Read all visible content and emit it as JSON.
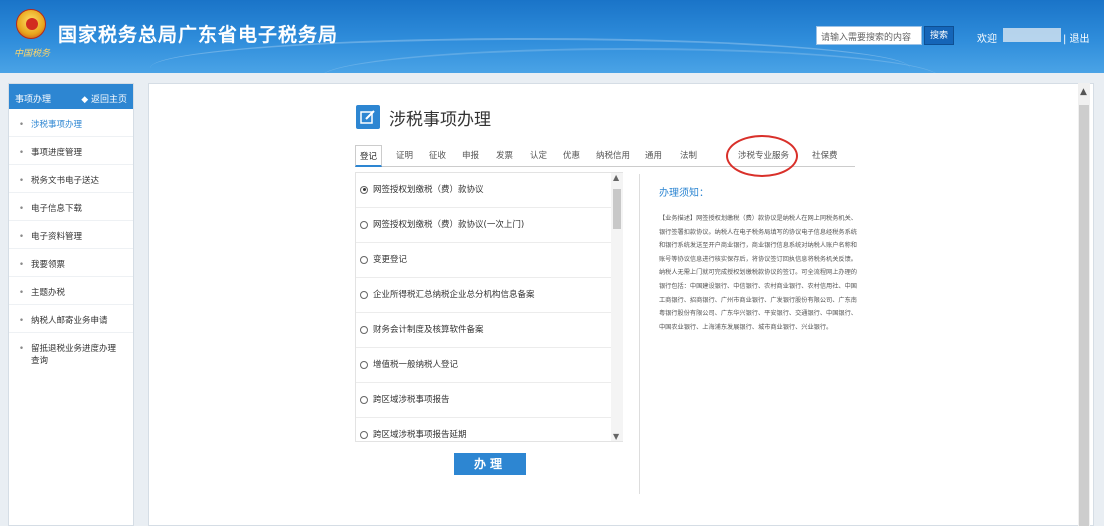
{
  "header": {
    "title": "国家税务总局广东省电子税务局",
    "signature": "中国税务",
    "search_placeholder": "请输入需要搜索的内容",
    "search_button": "搜索",
    "welcome": "欢迎",
    "logout": "| 退出"
  },
  "sidebar": {
    "title": "事项办理",
    "home_link": "◆ 返回主页",
    "items": [
      {
        "label": "涉税事项办理",
        "active": true
      },
      {
        "label": "事项进度管理"
      },
      {
        "label": "税务文书电子送达"
      },
      {
        "label": "电子信息下载"
      },
      {
        "label": "电子资料管理"
      },
      {
        "label": "我要领票"
      },
      {
        "label": "主题办税"
      },
      {
        "label": "纳税人邮寄业务申请"
      },
      {
        "label": "留抵退税业务进度办理查询"
      }
    ]
  },
  "main": {
    "title": "涉税事项办理",
    "tabs": [
      "登记",
      "证明",
      "征收",
      "申报",
      "发票",
      "认定",
      "优惠",
      "纳税信用",
      "通用",
      "法制",
      "涉税专业服务",
      "社保费"
    ],
    "active_tab": "登记",
    "items": [
      {
        "label": "网签授权划缴税（费）款协议",
        "selected": true
      },
      {
        "label": "网签授权划缴税（费）款协议(一次上门)"
      },
      {
        "label": "变更登记"
      },
      {
        "label": "企业所得税汇总纳税企业总分机构信息备案"
      },
      {
        "label": "财务会计制度及核算软件备案"
      },
      {
        "label": "增值税一般纳税人登记"
      },
      {
        "label": "跨区域涉税事项报告"
      },
      {
        "label": "跨区域涉税事项报告延期"
      }
    ],
    "submit_button": "办理",
    "notice_title": "办理须知：",
    "notice_body": "【业务描述】网签授权划缴税（费）款协议是纳税人在网上同税务机关、银行签署扣款协议。纳税人在电子税务局填写的协议电子信息经税务系统和银行系统发送至开户商业银行，商业银行信息系统对纳税人账户名称和账号等协议信息进行核实保存后，将协议签订回执信息将税务机关反馈。纳税人无需上门就可完成授权划缴税款协议的签订。可全流程网上办理的银行包括：中国建设银行、中信银行、农村商业银行、农村信用社、中国工商银行、招商银行、广州市商业银行、广发银行股份有限公司、广东南粤银行股份有限公司、广东华兴银行、平安银行、交通银行、中国银行、中国农业银行、上海浦东发展银行、城市商业银行、兴业银行。"
  },
  "colors": {
    "header_blue": "#2f8ddb",
    "accent_blue": "#2d86d2",
    "highlight_red": "#d9302a"
  }
}
